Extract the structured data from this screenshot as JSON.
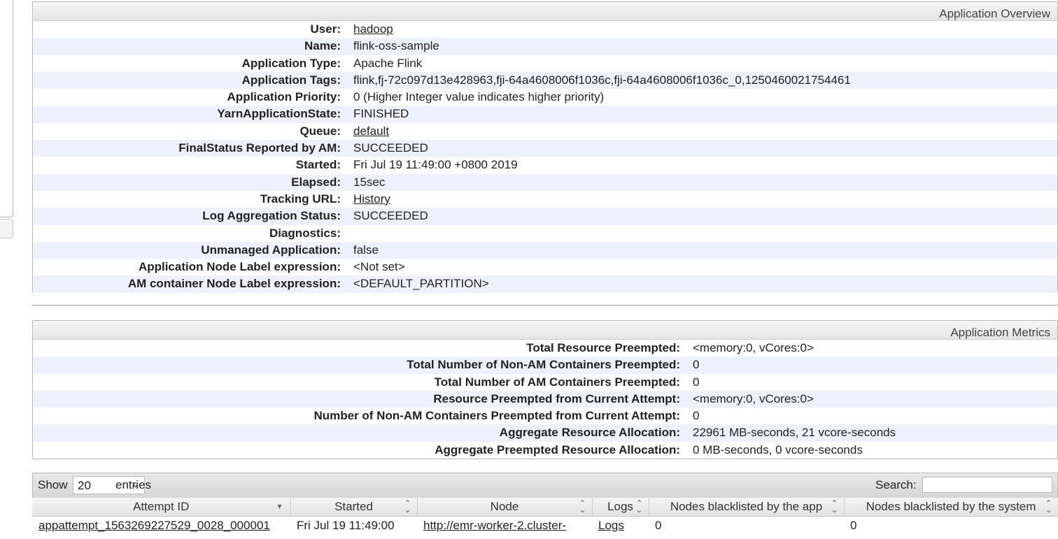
{
  "overview": {
    "title": "Application Overview",
    "rows": [
      {
        "label": "User:",
        "value": "hadoop",
        "link": true
      },
      {
        "label": "Name:",
        "value": "flink-oss-sample"
      },
      {
        "label": "Application Type:",
        "value": "Apache Flink"
      },
      {
        "label": "Application Tags:",
        "value": "flink,fj-72c097d13e428963,fji-64a4608006f1036c,fji-64a4608006f1036c_0,1250460021754461"
      },
      {
        "label": "Application Priority:",
        "value": "0 (Higher Integer value indicates higher priority)"
      },
      {
        "label": "YarnApplicationState:",
        "value": "FINISHED"
      },
      {
        "label": "Queue:",
        "value": "default",
        "link": true
      },
      {
        "label": "FinalStatus Reported by AM:",
        "value": "SUCCEEDED"
      },
      {
        "label": "Started:",
        "value": "Fri Jul 19 11:49:00 +0800 2019"
      },
      {
        "label": "Elapsed:",
        "value": "15sec"
      },
      {
        "label": "Tracking URL:",
        "value": "History",
        "link": true
      },
      {
        "label": "Log Aggregation Status:",
        "value": "SUCCEEDED"
      },
      {
        "label": "Diagnostics:",
        "value": ""
      },
      {
        "label": "Unmanaged Application:",
        "value": "false"
      },
      {
        "label": "Application Node Label expression:",
        "value": "<Not set>"
      },
      {
        "label": "AM container Node Label expression:",
        "value": "<DEFAULT_PARTITION>"
      }
    ]
  },
  "metrics": {
    "title": "Application Metrics",
    "rows": [
      {
        "label": "Total Resource Preempted:",
        "value": "<memory:0, vCores:0>"
      },
      {
        "label": "Total Number of Non-AM Containers Preempted:",
        "value": "0"
      },
      {
        "label": "Total Number of AM Containers Preempted:",
        "value": "0"
      },
      {
        "label": "Resource Preempted from Current Attempt:",
        "value": "<memory:0, vCores:0>"
      },
      {
        "label": "Number of Non-AM Containers Preempted from Current Attempt:",
        "value": "0"
      },
      {
        "label": "Aggregate Resource Allocation:",
        "value": "22961 MB-seconds, 21 vcore-seconds"
      },
      {
        "label": "Aggregate Preempted Resource Allocation:",
        "value": "0 MB-seconds, 0 vcore-seconds"
      }
    ]
  },
  "table": {
    "show_label": "Show",
    "page_size": "20",
    "entries_label": "entries",
    "search_label": "Search:",
    "search_value": "",
    "columns": [
      "Attempt ID",
      "Started",
      "Node",
      "Logs",
      "Nodes blacklisted by the app",
      "Nodes blacklisted by the system"
    ],
    "rows": [
      [
        "appattempt_1563269227529_0028_000001",
        "Fri Jul 19 11:49:00",
        "http://emr-worker-2.cluster-",
        "Logs",
        "0",
        "0"
      ]
    ]
  }
}
